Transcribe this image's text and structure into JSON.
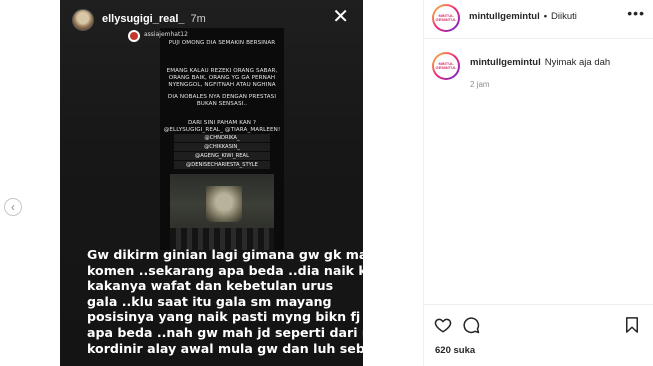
{
  "story": {
    "username": "ellysugigi_real_",
    "time": "7m",
    "repost": {
      "username": "assiajemhat12",
      "lines": [
        "PUJI OMONG DIA SEMAKIN BERSINAR",
        "EMANG KALAU REZEKI ORANG SABAR, ORANG BAIK, ORANG YG GA PERNAH NYENGGOL, NGFITNAH ATAU NGHINA",
        "DIA NOBALES NYA DENGAN PRESTASI BUKAN SENSASI..",
        "DARI SINI PAHAM KAN ? @ELLYSUGIGI_REAL_ @TIARA_MARLEEN!"
      ],
      "tags": [
        "@CHNDRIKA_",
        "@CHIKKASIN_",
        "@AGENG_KIWI_REAL",
        "@DENISECHARIESTA_STYLE"
      ]
    },
    "caption_lines": [
      "Gw dikirm ginian lagi gimana gw gk mau",
      "komen ..sekarang apa beda ..dia naik karna",
      "kakanya wafat dan kebetulan urus",
      "gala ..klu saat itu gala sm mayang",
      "posisinya yang naik pasti myng bikn fj ..jd",
      "apa beda ..nah gw mah jd seperti dari nol jd",
      "kordinir alay awal mula gw dan luh sebut"
    ]
  },
  "panel": {
    "logo_text": [
      "MINTUL",
      "GEMINTUL"
    ],
    "username": "mintullgemintul",
    "follow_status": "Diikuti",
    "comment": {
      "username": "mintullgemintul",
      "text": "Nyimak aja dah",
      "time": "2 jam"
    },
    "likes": "620 suka"
  },
  "icons": {
    "more": "more-options-icon",
    "like": "heart-icon",
    "comment": "comment-bubble-icon",
    "save": "bookmark-icon",
    "close": "close-icon",
    "prev": "chevron-left-icon"
  }
}
